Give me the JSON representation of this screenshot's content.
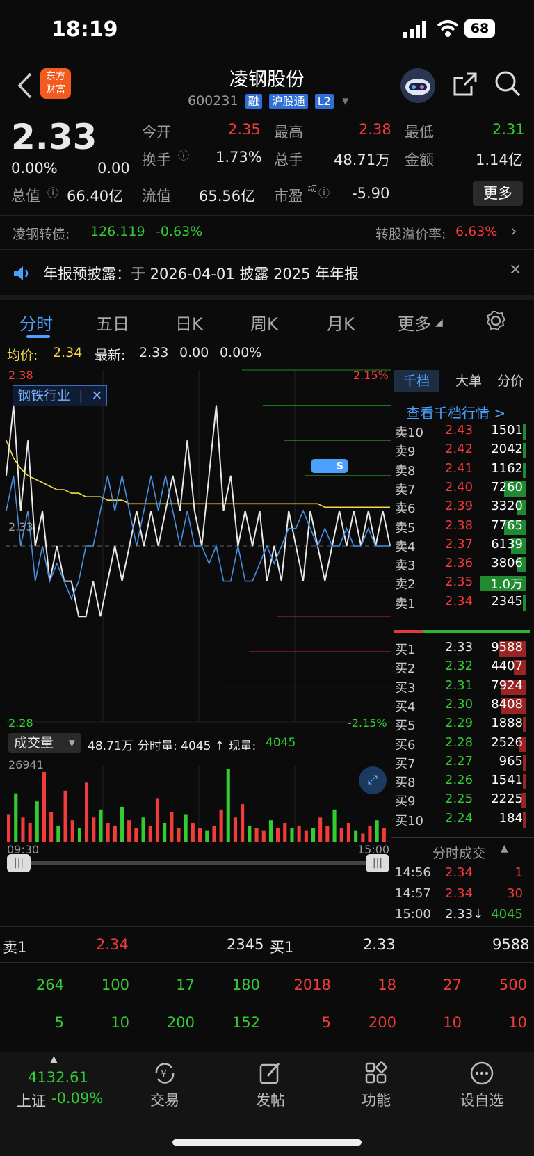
{
  "status": {
    "time": "18:19",
    "battery": "68"
  },
  "header": {
    "title": "凌钢股份",
    "code": "600231",
    "tags": [
      "融",
      "沪股通",
      "L2"
    ],
    "logo_line1": "东方",
    "logo_line2": "财富"
  },
  "quote": {
    "price": "2.33",
    "change_pct": "0.00%",
    "change": "0.00",
    "open_label": "今开",
    "open": "2.35",
    "high_label": "最高",
    "high": "2.38",
    "low_label": "最低",
    "low": "2.31",
    "turnover_label": "换手",
    "turnover": "1.73%",
    "volume_label": "总手",
    "volume": "48.71万",
    "amount_label": "金额",
    "amount": "1.14亿",
    "mktcap_label": "总值",
    "mktcap": "66.40亿",
    "float_label": "流值",
    "float": "65.56亿",
    "pe_label": "市盈",
    "pe_sup": "动",
    "pe": "-5.90",
    "more": "更多"
  },
  "bond": {
    "name": "凌钢转债:",
    "price": "126.119",
    "pct": "-0.63%",
    "premium_label": "转股溢价率:",
    "premium": "6.63%"
  },
  "notice": {
    "text": "年报预披露：于 2026-04-01 披露 2025 年年报"
  },
  "tabs": [
    "分时",
    "五日",
    "日K",
    "周K",
    "月K",
    "更多"
  ],
  "avgline": {
    "avg_label": "均价:",
    "avg": "2.34",
    "latest_label": "最新:",
    "latest": "2.33",
    "chg": "0.00",
    "pct": "0.00%"
  },
  "chart": {
    "top_price": "2.38",
    "bottom_price": "2.28",
    "mid_price": "2.33",
    "top_pct": "2.15%",
    "bottom_pct": "-2.15%",
    "industry_tag": "钢铁行业",
    "volume_label": "成交量",
    "vol_total": "48.71万",
    "vol_detail": "分时量: 4045 ↑ 现量:",
    "vol_now": "4045",
    "vol_max": "26941",
    "time_start": "09:30",
    "time_end": "15:00",
    "marker": "S"
  },
  "chart_data": {
    "type": "line",
    "title": "",
    "ylim": [
      2.28,
      2.38
    ],
    "series": [
      {
        "name": "",
        "values": [
          2.35,
          2.37,
          2.34,
          2.36,
          2.33,
          2.34,
          2.32,
          2.33,
          2.32,
          2.32,
          2.31,
          2.31,
          2.32,
          2.31,
          2.32,
          2.33,
          2.32,
          2.33,
          2.34,
          2.33,
          2.34,
          2.33,
          2.34,
          2.35,
          2.34,
          2.36,
          2.34,
          2.33,
          2.35,
          2.37,
          2.34,
          2.35,
          2.33,
          2.34,
          2.33,
          2.34,
          2.32,
          2.33,
          2.32,
          2.34,
          2.33,
          2.32,
          2.34,
          2.33,
          2.32,
          2.33,
          2.34,
          2.33,
          2.34,
          2.33,
          2.34,
          2.33,
          2.34,
          2.33
        ]
      },
      {
        "name": "",
        "values": [
          2.36,
          2.355,
          2.352,
          2.35,
          2.349,
          2.348,
          2.347,
          2.346,
          2.346,
          2.345,
          2.345,
          2.344,
          2.344,
          2.344,
          2.343,
          2.343,
          2.343,
          2.342,
          2.342,
          2.342,
          2.342,
          2.342,
          2.342,
          2.342,
          2.342,
          2.342,
          2.342,
          2.342,
          2.342,
          2.342,
          2.342,
          2.342,
          2.342,
          2.342,
          2.342,
          2.342,
          2.342,
          2.342,
          2.342,
          2.342,
          2.342,
          2.342,
          2.342,
          2.342,
          2.341,
          2.341,
          2.341,
          2.341,
          2.341,
          2.341,
          2.341,
          2.341,
          2.341,
          2.341
        ]
      },
      {
        "name": "",
        "values": [
          2.34,
          2.35,
          2.33,
          2.34,
          2.32,
          2.33,
          2.32,
          2.325,
          2.32,
          2.315,
          2.32,
          2.33,
          2.33,
          2.34,
          2.35,
          2.34,
          2.35,
          2.34,
          2.33,
          2.34,
          2.35,
          2.34,
          2.35,
          2.34,
          2.33,
          2.34,
          2.33,
          2.33,
          2.325,
          2.33,
          2.32,
          2.32,
          2.33,
          2.32,
          2.32,
          2.325,
          2.33,
          2.325,
          2.33,
          2.335,
          2.335,
          2.34,
          2.335,
          2.33,
          2.335,
          2.33,
          2.33,
          2.335,
          2.33,
          2.33,
          2.335,
          2.33,
          2.33,
          2.33
        ]
      }
    ],
    "volumes": [
      10,
      18,
      9,
      7,
      15,
      26,
      11,
      6,
      19,
      8,
      5,
      22,
      9,
      12,
      7,
      6,
      13,
      8,
      5,
      9,
      6,
      16,
      7,
      11,
      5,
      10,
      7,
      5,
      4,
      6,
      12,
      27,
      9,
      14,
      6,
      5,
      4,
      8,
      5,
      7,
      5,
      6,
      4,
      5,
      9,
      6,
      12,
      5,
      7,
      4,
      3,
      6,
      8,
      5
    ]
  },
  "orderbook": {
    "tabs": [
      "千档",
      "大单",
      "分价"
    ],
    "link": "查看千档行情 >",
    "asks": [
      {
        "label": "卖10",
        "price": "2.43",
        "vol": "1501"
      },
      {
        "label": "卖9",
        "price": "2.42",
        "vol": "2042"
      },
      {
        "label": "卖8",
        "price": "2.41",
        "vol": "1162"
      },
      {
        "label": "卖7",
        "price": "2.40",
        "vol": "7260"
      },
      {
        "label": "卖6",
        "price": "2.39",
        "vol": "3320"
      },
      {
        "label": "卖5",
        "price": "2.38",
        "vol": "7765"
      },
      {
        "label": "卖4",
        "price": "2.37",
        "vol": "6139"
      },
      {
        "label": "卖3",
        "price": "2.36",
        "vol": "3806"
      },
      {
        "label": "卖2",
        "price": "2.35",
        "vol": "1.0万"
      },
      {
        "label": "卖1",
        "price": "2.34",
        "vol": "2345"
      }
    ],
    "ask_bars": [
      0.05,
      0.05,
      0.05,
      0.45,
      0.18,
      0.45,
      0.3,
      0.18,
      0.95,
      0.05
    ],
    "bids": [
      {
        "label": "买1",
        "price": "2.33",
        "vol": "9588"
      },
      {
        "label": "买2",
        "price": "2.32",
        "vol": "4407"
      },
      {
        "label": "买3",
        "price": "2.31",
        "vol": "7924"
      },
      {
        "label": "买4",
        "price": "2.30",
        "vol": "8408"
      },
      {
        "label": "买5",
        "price": "2.29",
        "vol": "1888"
      },
      {
        "label": "买6",
        "price": "2.28",
        "vol": "2526"
      },
      {
        "label": "买7",
        "price": "2.27",
        "vol": "965"
      },
      {
        "label": "买8",
        "price": "2.26",
        "vol": "1541"
      },
      {
        "label": "买9",
        "price": "2.25",
        "vol": "2225"
      },
      {
        "label": "买10",
        "price": "2.24",
        "vol": "184"
      }
    ],
    "bid_bars": [
      0.55,
      0.25,
      0.5,
      0.52,
      0.05,
      0.15,
      0.02,
      0.05,
      0.08,
      0.02
    ],
    "ticks_title": "分时成交",
    "ticks": [
      {
        "time": "14:56",
        "price": "2.34",
        "vol": "1"
      },
      {
        "time": "14:57",
        "price": "2.34",
        "vol": "30"
      },
      {
        "time": "15:00",
        "price": "2.33↓",
        "vol": "4045"
      }
    ]
  },
  "levels": {
    "sell1_label": "卖1",
    "sell1_price": "2.34",
    "sell1_vol": "2345",
    "buy1_label": "买1",
    "buy1_price": "2.33",
    "buy1_vol": "9588",
    "sell_row1": [
      "264",
      "100",
      "17",
      "180"
    ],
    "sell_row2": [
      "5",
      "10",
      "200",
      "152"
    ],
    "buy_row1": [
      "2018",
      "18",
      "27",
      "500"
    ],
    "buy_row2": [
      "5",
      "200",
      "10",
      "10"
    ]
  },
  "bottom": {
    "index_value": "4132.61",
    "index_name": "上证",
    "index_pct": "-0.09%",
    "nav": [
      "交易",
      "发帖",
      "功能",
      "设自选"
    ]
  },
  "colors": {
    "up": "#f23b3b",
    "down": "#33cc33",
    "avg": "#f5d94a",
    "accent": "#4aa0ff"
  }
}
